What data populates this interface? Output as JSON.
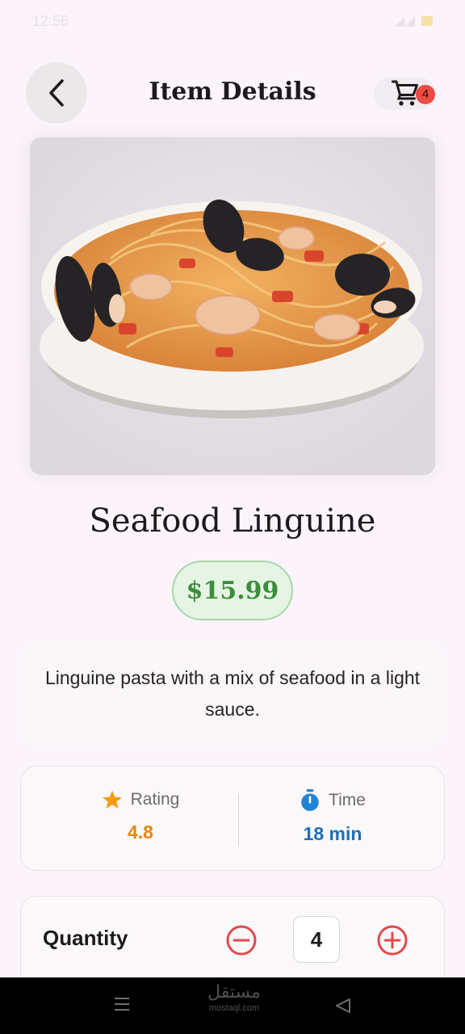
{
  "status_bar": {
    "time": "12:56"
  },
  "header": {
    "title": "Item Details",
    "cart_count": "4"
  },
  "item": {
    "name": "Seafood Linguine",
    "price": "$15.99",
    "description": "Linguine pasta with a mix of seafood in a light sauce.",
    "image": "seafood-linguine-photo"
  },
  "stats": {
    "rating_label": "Rating",
    "rating_value": "4.8",
    "time_label": "Time",
    "time_value": "18 min"
  },
  "quantity": {
    "label": "Quantity",
    "value": "4"
  },
  "watermark": {
    "arabic": "مستقل",
    "latin": "mostaql.com"
  },
  "colors": {
    "background": "#fcf4fb",
    "price_green": "#3b8e3c",
    "rating_orange": "#e8850b",
    "time_blue": "#1f6fb5",
    "stepper_red": "#e2494a",
    "badge_red": "#ee4b45"
  },
  "icons": {
    "back": "chevron-left-icon",
    "cart": "shopping-cart-icon",
    "rating": "star-icon",
    "time": "stopwatch-icon",
    "minus": "minus-circle-icon",
    "plus": "plus-circle-icon",
    "nav_menu": "menu-icon",
    "nav_back": "triangle-back-icon"
  }
}
